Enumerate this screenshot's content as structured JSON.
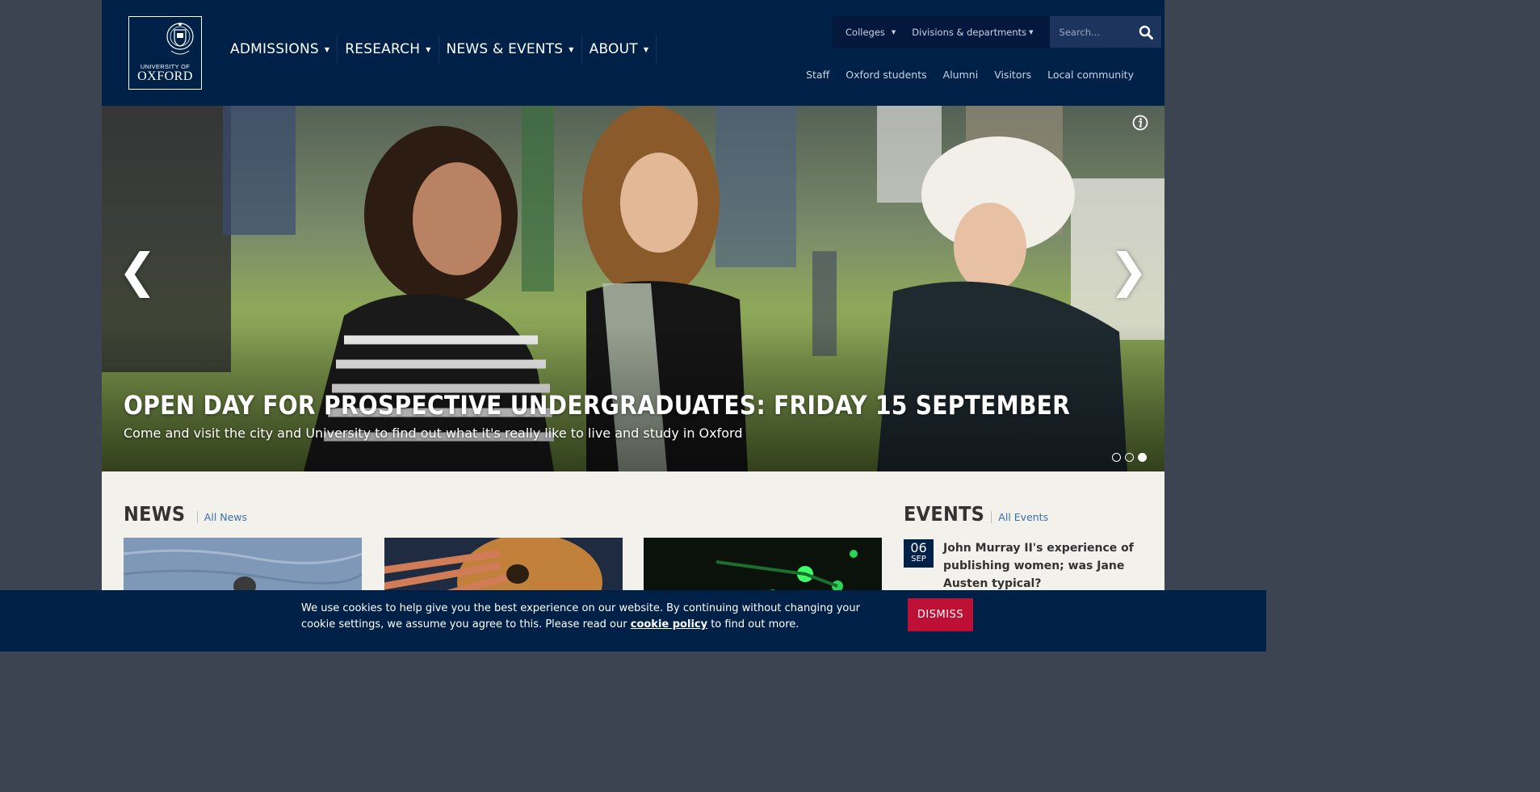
{
  "logo": {
    "line1": "UNIVERSITY OF",
    "line2": "OXFORD"
  },
  "mainnav": [
    {
      "label": "ADMISSIONS"
    },
    {
      "label": "RESEARCH"
    },
    {
      "label": "NEWS & EVENTS"
    },
    {
      "label": "ABOUT"
    }
  ],
  "utility": {
    "colleges": "Colleges",
    "divisions": "Divisions & departments",
    "search_placeholder": "Search..."
  },
  "audience": [
    "Staff",
    "Oxford students",
    "Alumni",
    "Visitors",
    "Local community"
  ],
  "hero": {
    "title": "OPEN DAY FOR PROSPECTIVE UNDERGRADUATES: FRIDAY 15 SEPTEMBER",
    "subtitle": "Come and visit the city and University to find out what it's really like to live and study in Oxford",
    "prev": "❮",
    "next": "❯",
    "slides_total": 3,
    "slide_active": 3
  },
  "news": {
    "heading": "NEWS",
    "link": "All News"
  },
  "events": {
    "heading": "EVENTS",
    "link": "All Events",
    "items": [
      {
        "day": "06",
        "month": "SEP",
        "title": "John Murray II's experience of publishing women; was Jane Austen typical?"
      }
    ]
  },
  "cookie": {
    "text_before": "We use cookies to help give you the best experience on our website. By continuing without changing your cookie settings, we assume you agree to this. Please read our ",
    "link": "cookie policy",
    "text_after": " to find out more.",
    "dismiss": "DISMISS"
  },
  "colors": {
    "oxford_blue": "#002147",
    "dismiss_red": "#be0f34",
    "link_blue": "#3b6fa8"
  }
}
